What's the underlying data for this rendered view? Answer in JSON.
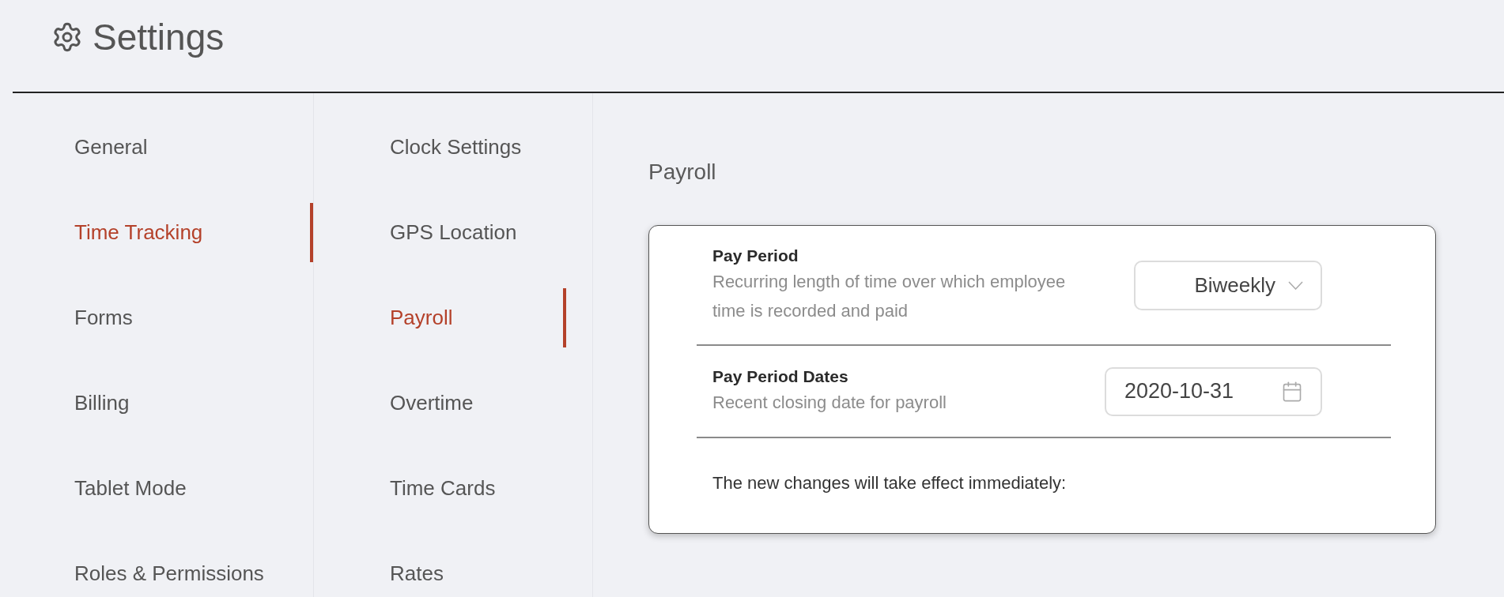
{
  "header": {
    "title": "Settings"
  },
  "nav_primary": [
    {
      "label": "General",
      "selected": false
    },
    {
      "label": "Time Tracking",
      "selected": true
    },
    {
      "label": "Forms",
      "selected": false
    },
    {
      "label": "Billing",
      "selected": false
    },
    {
      "label": "Tablet Mode",
      "selected": false
    },
    {
      "label": "Roles & Permissions",
      "selected": false
    }
  ],
  "nav_secondary": [
    {
      "label": "Clock Settings",
      "selected": false
    },
    {
      "label": "GPS Location",
      "selected": false
    },
    {
      "label": "Payroll",
      "selected": true
    },
    {
      "label": "Overtime",
      "selected": false
    },
    {
      "label": "Time Cards",
      "selected": false
    },
    {
      "label": "Rates",
      "selected": false
    }
  ],
  "content": {
    "title": "Payroll",
    "settings": [
      {
        "kind": "select",
        "label": "Pay Period",
        "description": "Recurring length of time over which employee time is recorded and paid",
        "value": "Biweekly"
      },
      {
        "kind": "date",
        "label": "Pay Period Dates",
        "description": "Recent closing date for payroll",
        "value": "2020-10-31"
      }
    ],
    "note": "The new changes will take effect immediately:"
  }
}
